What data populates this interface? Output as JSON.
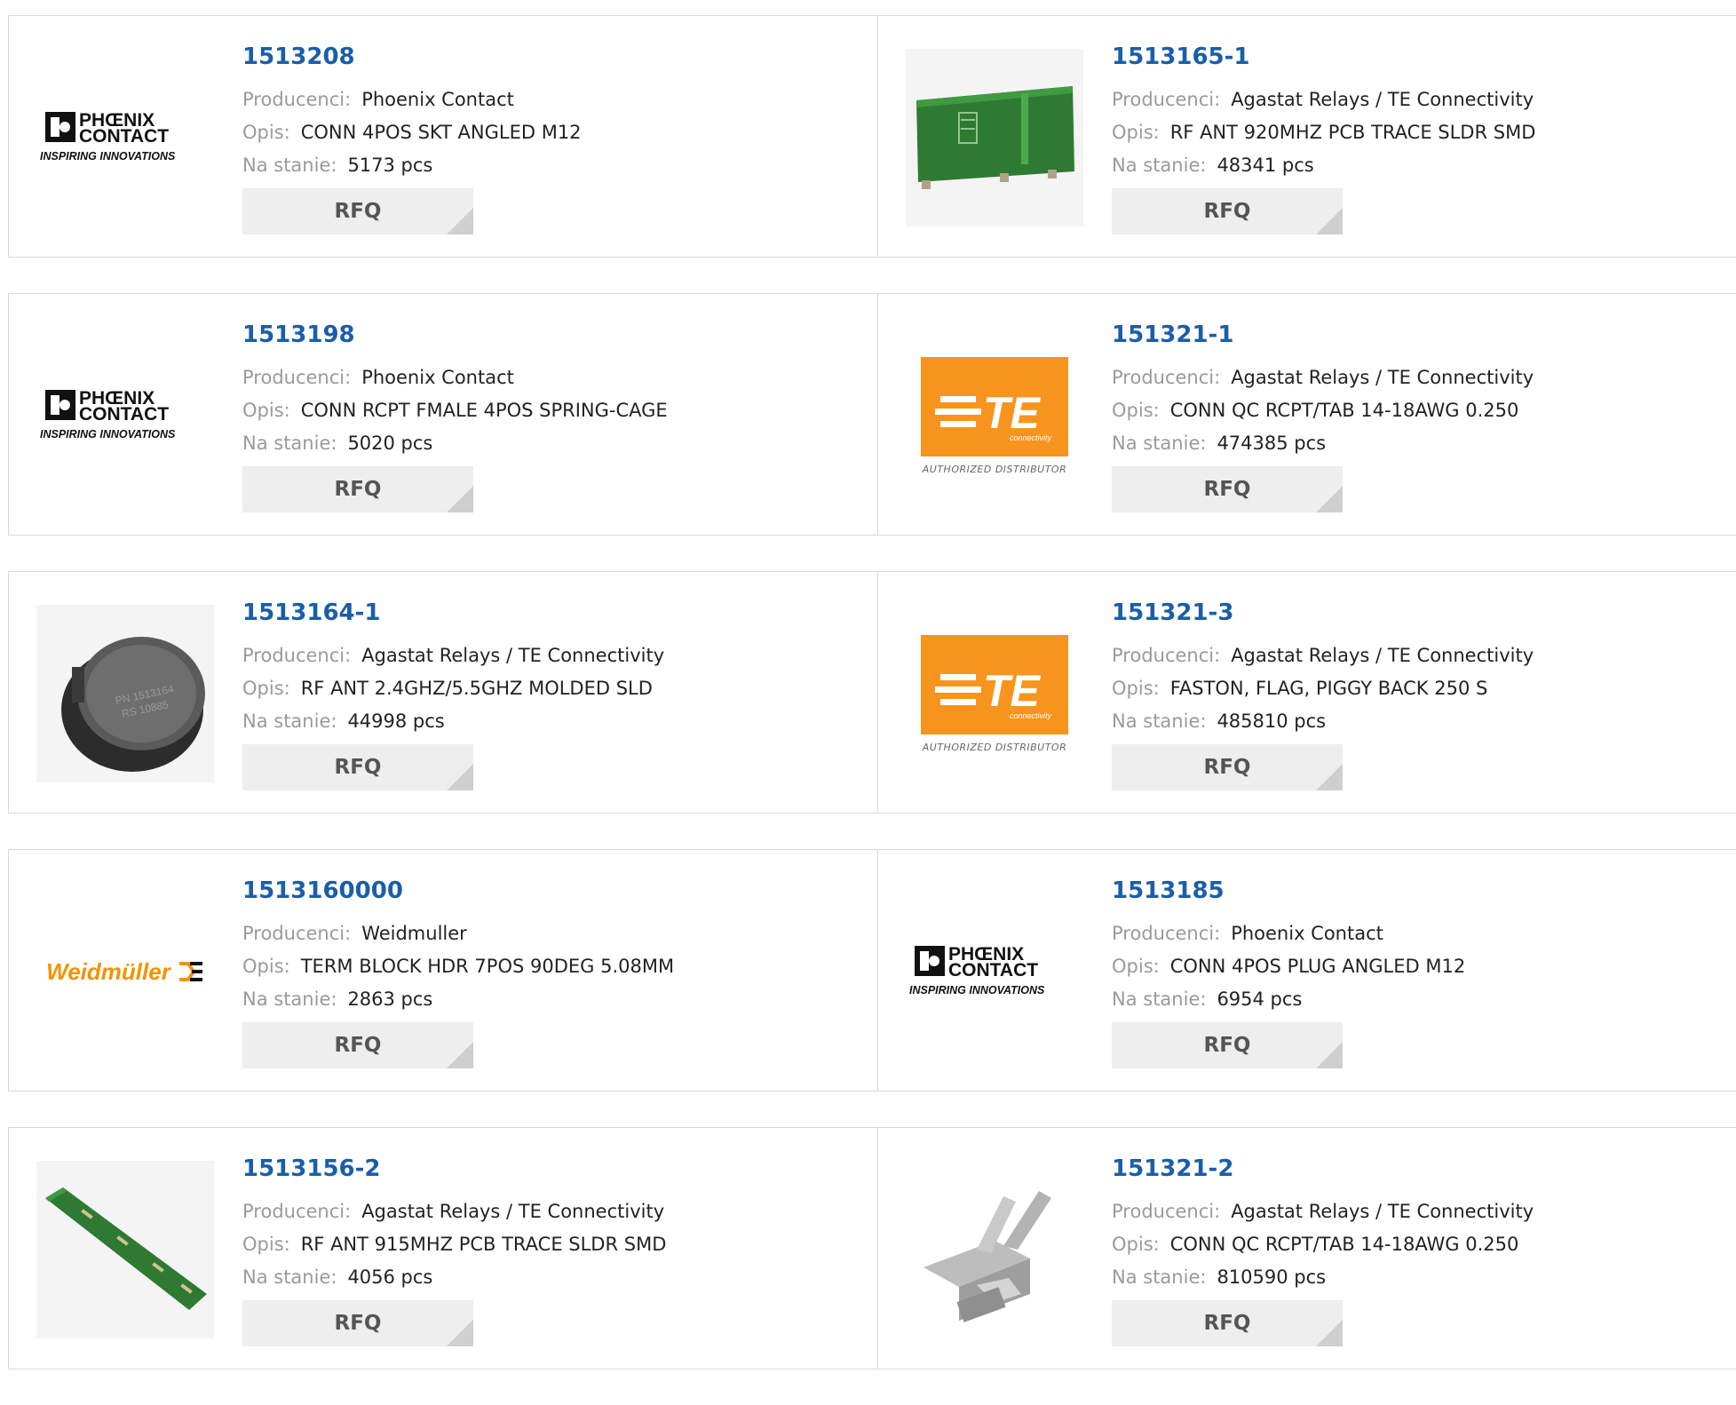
{
  "labels": {
    "manufacturer": "Producenci:",
    "description": "Opis:",
    "stock": "Na stanie:",
    "rfq": "RFQ"
  },
  "logos": {
    "phoenix_line1": "PHŒNIX",
    "phoenix_line2": "CONTACT",
    "phoenix_tagline": "INSPIRING INNOVATIONS",
    "te_mark": "TE",
    "te_sub": "connectivity",
    "te_distributor": "AUTHORIZED DISTRIBUTOR",
    "weidmuller": "Weidmüller"
  },
  "colors": {
    "link": "#1a5ea8",
    "phoenix": "#111111",
    "te_orange": "#f7941d",
    "weidmuller_orange": "#f29400"
  },
  "products": [
    {
      "pn": "1513208",
      "manufacturer": "Phoenix Contact",
      "description": "CONN 4POS SKT ANGLED M12",
      "stock": "5173 pcs",
      "image": "phoenix-contact-logo"
    },
    {
      "pn": "1513165-1",
      "manufacturer": "Agastat Relays / TE Connectivity",
      "description": "RF ANT 920MHZ PCB TRACE SLDR SMD",
      "stock": "48341 pcs",
      "image": "pcb-antenna-photo"
    },
    {
      "pn": "1513198",
      "manufacturer": "Phoenix Contact",
      "description": "CONN RCPT FMALE 4POS SPRING-CAGE",
      "stock": "5020 pcs",
      "image": "phoenix-contact-logo"
    },
    {
      "pn": "151321-1",
      "manufacturer": "Agastat Relays / TE Connectivity",
      "description": "CONN QC RCPT/TAB 14-18AWG 0.250",
      "stock": "474385 pcs",
      "image": "te-connectivity-logo"
    },
    {
      "pn": "1513164-1",
      "manufacturer": "Agastat Relays / TE Connectivity",
      "description": "RF ANT 2.4GHZ/5.5GHZ MOLDED SLD",
      "stock": "44998 pcs",
      "image": "molded-antenna-photo"
    },
    {
      "pn": "151321-3",
      "manufacturer": "Agastat Relays / TE Connectivity",
      "description": "FASTON, FLAG, PIGGY BACK 250 S",
      "stock": "485810 pcs",
      "image": "te-connectivity-logo"
    },
    {
      "pn": "1513160000",
      "manufacturer": "Weidmuller",
      "description": "TERM BLOCK HDR 7POS 90DEG 5.08MM",
      "stock": "2863 pcs",
      "image": "weidmuller-logo"
    },
    {
      "pn": "1513185",
      "manufacturer": "Phoenix Contact",
      "description": "CONN 4POS PLUG ANGLED M12",
      "stock": "6954 pcs",
      "image": "phoenix-contact-logo"
    },
    {
      "pn": "1513156-2",
      "manufacturer": "Agastat Relays / TE Connectivity",
      "description": "RF ANT 915MHZ PCB TRACE SLDR SMD",
      "stock": "4056 pcs",
      "image": "pcb-strip-antenna-photo"
    },
    {
      "pn": "151321-2",
      "manufacturer": "Agastat Relays / TE Connectivity",
      "description": "CONN QC RCPT/TAB 14-18AWG 0.250",
      "stock": "810590 pcs",
      "image": "quick-connect-terminal-photo"
    }
  ]
}
